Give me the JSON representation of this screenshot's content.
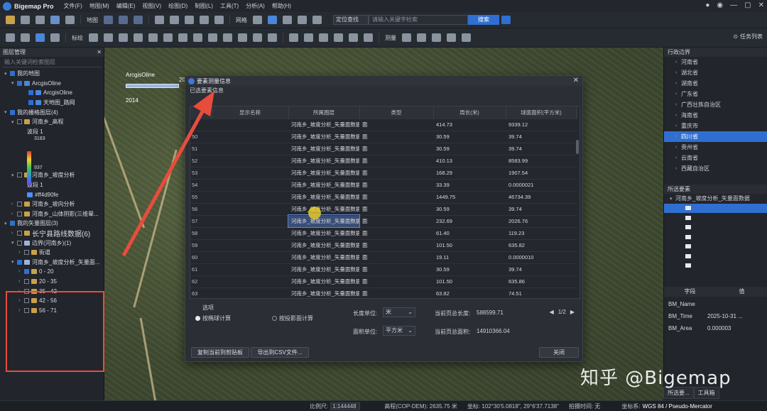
{
  "app": {
    "name": "Bigemap Pro",
    "menus": [
      "文件(F)",
      "地图(M)",
      "编辑(E)",
      "视图(V)",
      "绘图(D)",
      "制图(L)",
      "工具(T)",
      "分析(A)",
      "帮助(H)"
    ]
  },
  "toolbar1": {
    "map_label": "地图",
    "grid_label": "网格",
    "search_mode": "定位查找",
    "search_placeholder": "请输入关键字检索",
    "search_button": "搜索"
  },
  "toolbar2": {
    "mark_label": "标绘",
    "measure_label": "测量",
    "task_list": "任务列表"
  },
  "left_panel": {
    "title": "图层管理",
    "search_placeholder": "输入关键词检索图层",
    "my_maps": "我的地图",
    "arcgis1": "ArcgisOline",
    "arcgis2": "ArcgisOline",
    "tianditu": "天地图_路网",
    "raster_group": "我的栅格图层(4)",
    "elevation_layer": "河南乡_高程",
    "band1_a": "波段 1",
    "max_val": "3183",
    "min_val": "937",
    "slope_layer": "河南乡_坡度分析",
    "band1_b": "波段 1",
    "slope_color": "#ff4d90fe",
    "aspect_layer": "河南乡_坡向分析",
    "hillshade_layer": "河南乡_山体阴影(三维晕...",
    "vector_group": "我的矢量图层(3)",
    "roads_layer": "长宁县路线数据(6)",
    "boundary_layer": "边界(河南乡)(1)",
    "street_layer": "街道",
    "slope_vector": "河南乡_坡度分析_矢量面...",
    "classes": [
      "0 - 20",
      "20 - 35",
      "35 - 42",
      "42 - 56",
      "56 - 71"
    ]
  },
  "map": {
    "basemap_label": "ArcgisOline",
    "year": "2014",
    "scale_year": "20"
  },
  "right_panel": {
    "title": "行政边界",
    "regions": [
      "河南省",
      "湖北省",
      "湖南省",
      "广东省",
      "广西壮族自治区",
      "海南省",
      "重庆市",
      "四川省",
      "贵州省",
      "云南省",
      "西藏自治区"
    ],
    "selected_region": "四川省",
    "selection_title": "所选要素",
    "selection_layer": "河南乡_坡度分析_矢量面数据",
    "field_header": "字段",
    "value_header": "值",
    "attrs": [
      {
        "field": "BM_Name",
        "value": ""
      },
      {
        "field": "BM_Time",
        "value": "2025-10-31 ..."
      },
      {
        "field": "BM_Area",
        "value": "0.000003"
      }
    ],
    "tabs": [
      "所选要...",
      "工具箱"
    ]
  },
  "dialog": {
    "title": "要素测量信息",
    "subtitle": "已选要素信息",
    "columns": [
      "",
      "显示名称",
      "所属图层",
      "类型",
      "周长(米)",
      "球面面积(平方米)"
    ],
    "rows": [
      {
        "idx": "",
        "layer": "河南乡_坡度分析_矢量面数据",
        "type": "面",
        "perimeter": "414.73",
        "area": "9339.12"
      },
      {
        "idx": "50",
        "layer": "河南乡_坡度分析_矢量面数据",
        "type": "面",
        "perimeter": "30.59",
        "area": "39.74"
      },
      {
        "idx": "51",
        "layer": "河南乡_坡度分析_矢量面数据",
        "type": "面",
        "perimeter": "30.59",
        "area": "39.74"
      },
      {
        "idx": "52",
        "layer": "河南乡_坡度分析_矢量面数据",
        "type": "面",
        "perimeter": "410.13",
        "area": "8583.99"
      },
      {
        "idx": "53",
        "layer": "河南乡_坡度分析_矢量面数据",
        "type": "面",
        "perimeter": "168.29",
        "area": "1907.54"
      },
      {
        "idx": "54",
        "layer": "河南乡_坡度分析_矢量面数据",
        "type": "面",
        "perimeter": "33.39",
        "area": "0.0000021"
      },
      {
        "idx": "55",
        "layer": "河南乡_坡度分析_矢量面数据",
        "type": "面",
        "perimeter": "1449.75",
        "area": "46734.39"
      },
      {
        "idx": "56",
        "layer": "河南乡_坡度分析_矢量面数据",
        "type": "面",
        "perimeter": "30.59",
        "area": "39.74"
      },
      {
        "idx": "57",
        "layer": "河南乡_坡度分析_矢量面数据",
        "type": "面",
        "perimeter": "232.69",
        "area": "2026.76"
      },
      {
        "idx": "58",
        "layer": "河南乡_坡度分析_矢量面数据",
        "type": "面",
        "perimeter": "61.40",
        "area": "119.23"
      },
      {
        "idx": "59",
        "layer": "河南乡_坡度分析_矢量面数据",
        "type": "面",
        "perimeter": "101.50",
        "area": "635.82"
      },
      {
        "idx": "60",
        "layer": "河南乡_坡度分析_矢量面数据",
        "type": "面",
        "perimeter": "19.11",
        "area": "0.0000010"
      },
      {
        "idx": "61",
        "layer": "河南乡_坡度分析_矢量面数据",
        "type": "面",
        "perimeter": "30.59",
        "area": "39.74"
      },
      {
        "idx": "62",
        "layer": "河南乡_坡度分析_矢量面数据",
        "type": "面",
        "perimeter": "101.50",
        "area": "635.86"
      },
      {
        "idx": "63",
        "layer": "河南乡_坡度分析_矢量面数据",
        "type": "面",
        "perimeter": "63.82",
        "area": "74.51"
      }
    ],
    "options_title": "选项",
    "radio_by_feature": "按椭球计算",
    "radio_by_projection": "按投影面计算",
    "length_unit_label": "长度单位:",
    "length_unit": "米",
    "area_unit_label": "面积单位:",
    "area_unit": "平方米",
    "page_length_label": "当前页总长度:",
    "page_length": "588599.71",
    "page_area_label": "当前页总面积:",
    "page_area": "14910366.04",
    "page": "1/2",
    "copy_button": "复制当前到剪贴板",
    "export_button": "导出到CSV文件...",
    "close_button": "关闭"
  },
  "watermark": "知乎 @Bigemap",
  "statusbar": {
    "scale_label": "比例尺:",
    "scale_value": "1:144448",
    "elevation": "高程(COP-DEM): 2635.75 米",
    "coords": "坐标: 102°30'5.0818\", 29°6'37.7138\"",
    "capture_time": "拍摄时间: 无",
    "crs_label": "坐标系:",
    "crs": "WGS 84 / Pseudo-Mercator"
  },
  "colors": {
    "accent": "#2f6fd1",
    "highlight_box": "#e84c3d"
  }
}
